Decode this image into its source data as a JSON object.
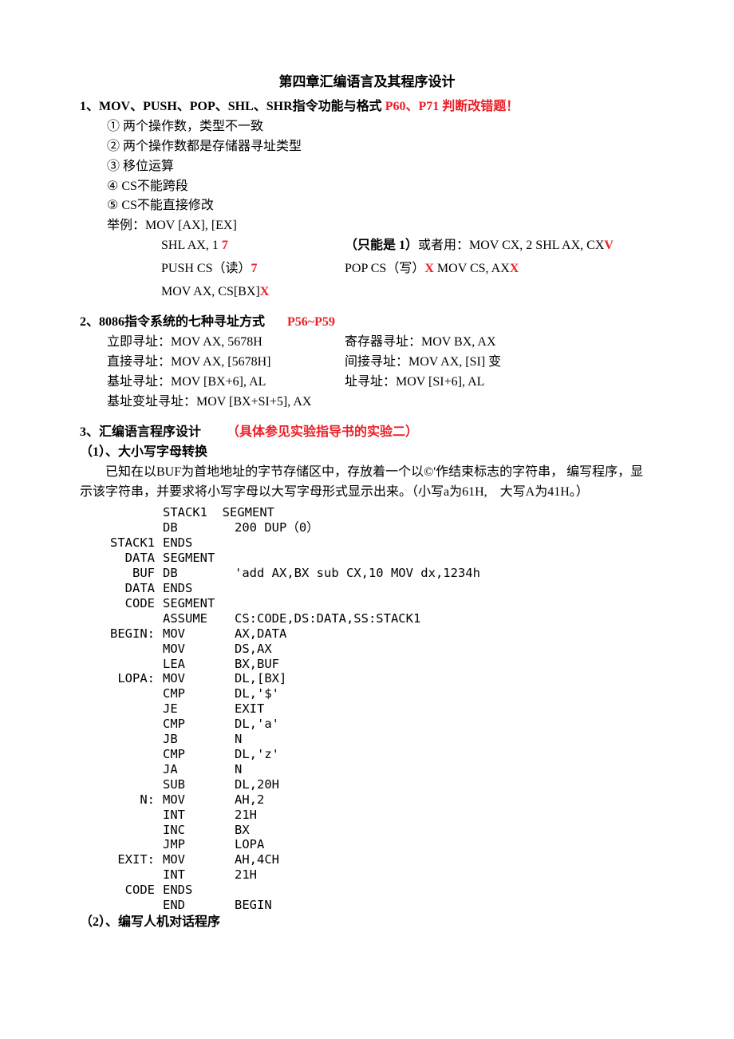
{
  "title": "第四章汇编语言及其程序设计",
  "section1": {
    "heading_prefix": "1、MOV、PUSH、POP、SHL、SHR指令功能与格式",
    "heading_red": " P60、P71 判断改错题！",
    "items": [
      "①    两个操作数，类型不一致",
      "②  两个操作数都是存储器寻址类型",
      "③  移位运算",
      "④  CS不能跨段",
      "⑤  CS不能直接修改"
    ],
    "example_label": "举例：",
    "ex1": "MOV [AX], [EX]",
    "ex2_left_a": "SHL AX, 1",
    "ex2_left_b": " 7",
    "ex2_right_a": "（只能是  1）",
    "ex2_right_b": "或者用：MOV CX, 2 SHL AX, CX",
    "ex2_right_c": "V",
    "ex3_left_a": "PUSH CS（读）",
    "ex3_left_b": "7",
    "ex3_right_a": "POP CS（写）",
    "ex3_right_b": "X",
    "ex3_right_c": "  MOV CS, AX",
    "ex3_right_d": "X",
    "ex4_a": "MOV AX, CS[BX]",
    "ex4_b": "X"
  },
  "section2": {
    "heading_prefix": "2、8086指令系统的七种寻址方式",
    "heading_red": "P56~P59",
    "r1c1": "立即寻址：MOV AX, 5678H",
    "r1c2": "寄存器寻址：MOV BX, AX",
    "r2c1": "直接寻址：MOV AX, [5678H]",
    "r2c2": "间接寻址：MOV AX, [SI] 变",
    "r3c1": "基址寻址：MOV [BX+6], AL",
    "r3c2": "址寻址：MOV [SI+6], AL",
    "r4": "基址变址寻址：MOV [BX+SI+5], AX"
  },
  "section3": {
    "heading_a": "3、汇编语言程序设计",
    "heading_b": "（具体参见实验指导书的实验二）",
    "sub1": "（1）、大小写字母转换",
    "para1": "已知在以BUF为首地地址的字节存储区中，存放着一个以©'作结束标志的字符串，   编写程序，显示该字符串，并要求将小写字母以大写字母形式显示出来。（小写a为61H,　大写A为41H。）",
    "code": [
      [
        "",
        "STACK1  SEGMENT",
        ""
      ],
      [
        "",
        "DB",
        "200 DUP（0）"
      ],
      [
        "STACK1",
        "ENDS",
        ""
      ],
      [
        "DATA",
        "SEGMENT",
        ""
      ],
      [
        "BUF",
        "DB",
        "'add AX,BX sub CX,10 MOV dx,1234h"
      ],
      [
        "DATA",
        "ENDS",
        ""
      ],
      [
        "CODE",
        "SEGMENT",
        ""
      ],
      [
        "",
        "ASSUME",
        "CS:CODE,DS:DATA,SS:STACK1"
      ],
      [
        "BEGIN:",
        "MOV",
        "AX,DATA"
      ],
      [
        "",
        "MOV",
        "DS,AX"
      ],
      [
        "",
        "LEA",
        "BX,BUF"
      ],
      [
        "LOPA:",
        "MOV",
        "DL,[BX]"
      ],
      [
        "",
        "CMP",
        "DL,'$'"
      ],
      [
        "",
        "JE",
        "EXIT"
      ],
      [
        "",
        "CMP",
        "DL,'a'"
      ],
      [
        "",
        "JB",
        "N"
      ],
      [
        "",
        "CMP",
        "DL,'z'"
      ],
      [
        "",
        "JA",
        "N"
      ],
      [
        "",
        "SUB",
        "DL,20H"
      ],
      [
        "N:",
        "MOV",
        "AH,2"
      ],
      [
        "",
        "INT",
        "21H"
      ],
      [
        "",
        "INC",
        "BX"
      ],
      [
        "",
        "JMP",
        "LOPA"
      ],
      [
        "EXIT:",
        "MOV",
        "AH,4CH"
      ],
      [
        "",
        "INT",
        "21H"
      ],
      [
        "CODE",
        "ENDS",
        ""
      ],
      [
        "",
        "END",
        "BEGIN"
      ]
    ],
    "sub2": "（2）、编写人机对话程序"
  }
}
